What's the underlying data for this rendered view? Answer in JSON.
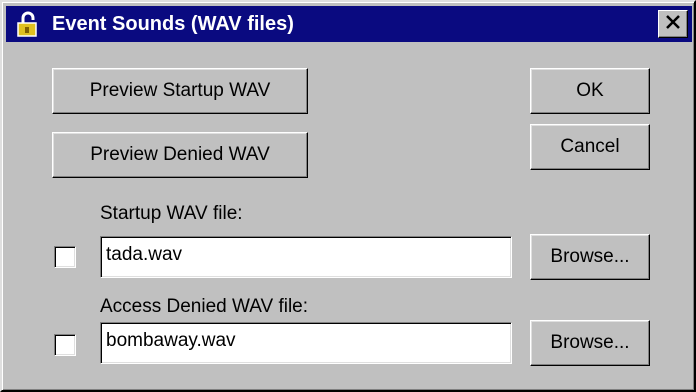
{
  "window": {
    "title": "Event Sounds (WAV files)",
    "close_label": "×"
  },
  "buttons": {
    "preview_startup": "Preview Startup WAV",
    "preview_denied": "Preview Denied WAV",
    "ok": "OK",
    "cancel": "Cancel",
    "browse_startup": "Browse...",
    "browse_denied": "Browse..."
  },
  "startup": {
    "label": "Startup WAV file:",
    "value": "tada.wav",
    "checked": false
  },
  "denied": {
    "label": "Access Denied WAV file:",
    "value": "bombaway.wav",
    "checked": false
  },
  "icons": {
    "title_icon": "padlock-icon",
    "close_icon": "close-icon"
  },
  "colors": {
    "titlebar": "#0a0a80",
    "face": "#c0c0c0"
  }
}
